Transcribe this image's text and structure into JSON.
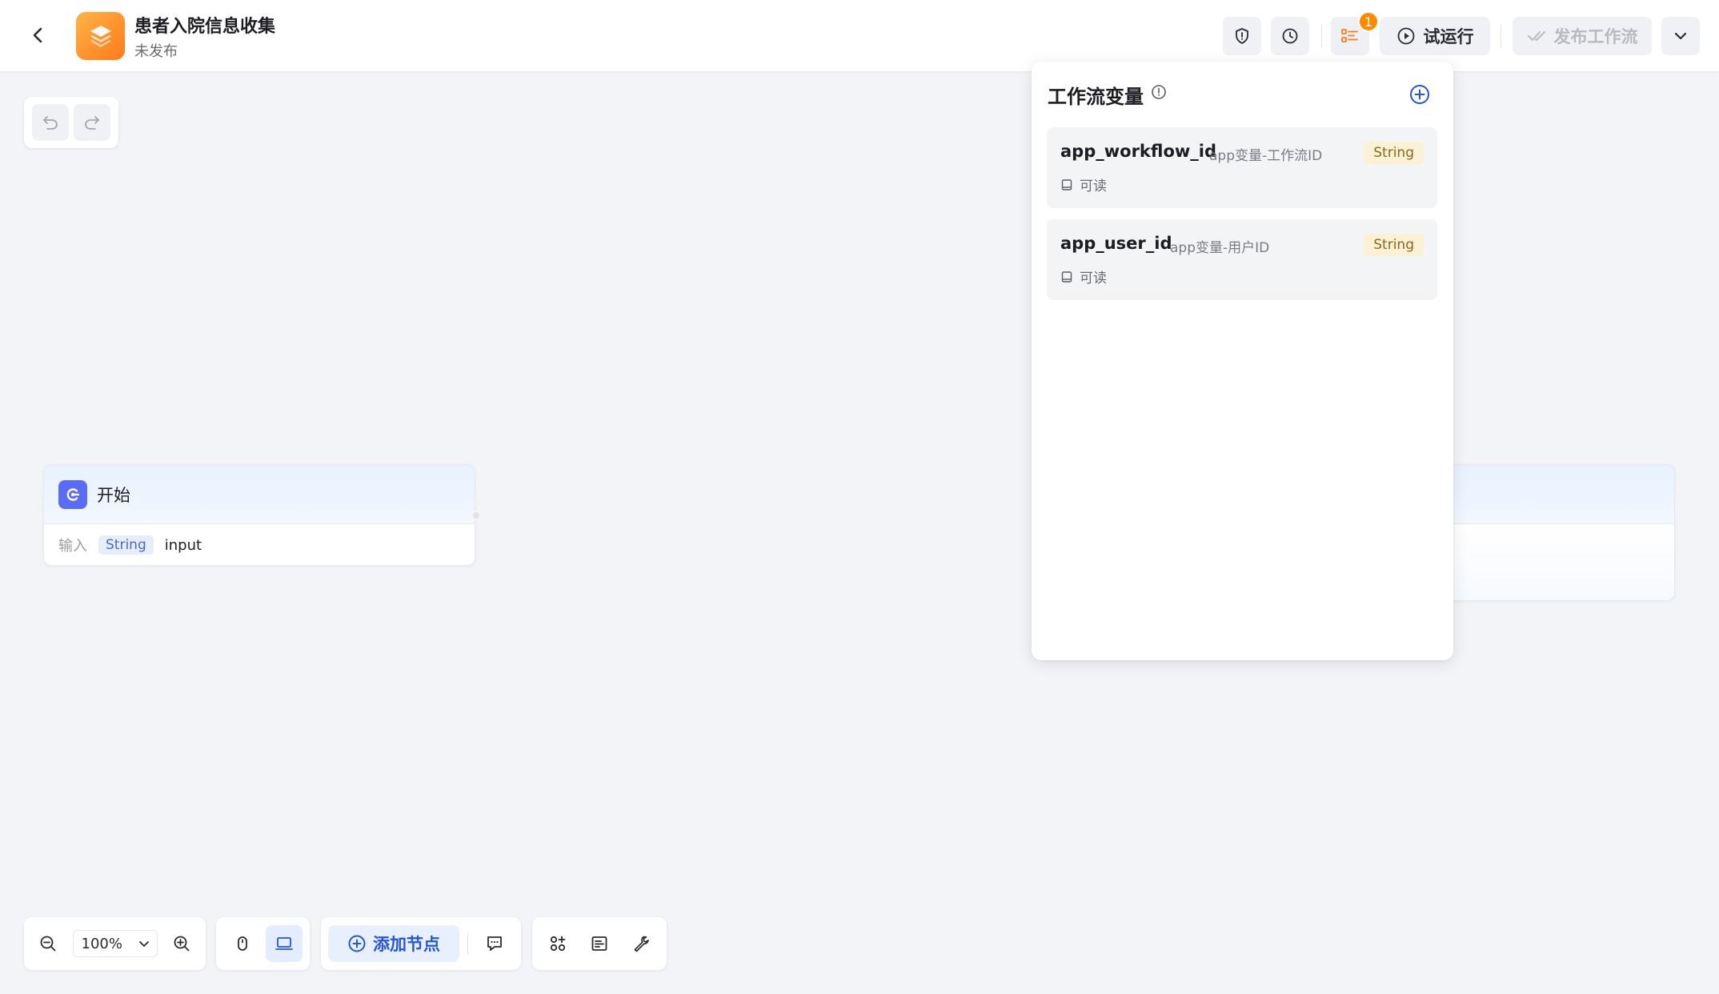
{
  "header": {
    "title": "患者入院信息收集",
    "status": "未发布",
    "notification_count": "1",
    "run_label": "试运行",
    "publish_label": "发布工作流"
  },
  "canvas": {
    "start_node": {
      "title": "开始",
      "input_label": "输入",
      "input_type": "String",
      "input_name": "input"
    }
  },
  "variable_panel": {
    "title": "工作流变量",
    "variables": [
      {
        "name": "app_workflow_id",
        "description": "app变量-工作流ID",
        "type": "String",
        "permission": "可读"
      },
      {
        "name": "app_user_id",
        "description": "app变量-用户ID",
        "type": "String",
        "permission": "可读"
      }
    ]
  },
  "toolbar": {
    "zoom": "100%",
    "add_node_label": "添加节点"
  },
  "colors": {
    "accent": "#2456d8",
    "brand_orange": "#ff7a1a",
    "badge": "#ff8a00",
    "string_tag_bg": "#fbf1d4"
  }
}
